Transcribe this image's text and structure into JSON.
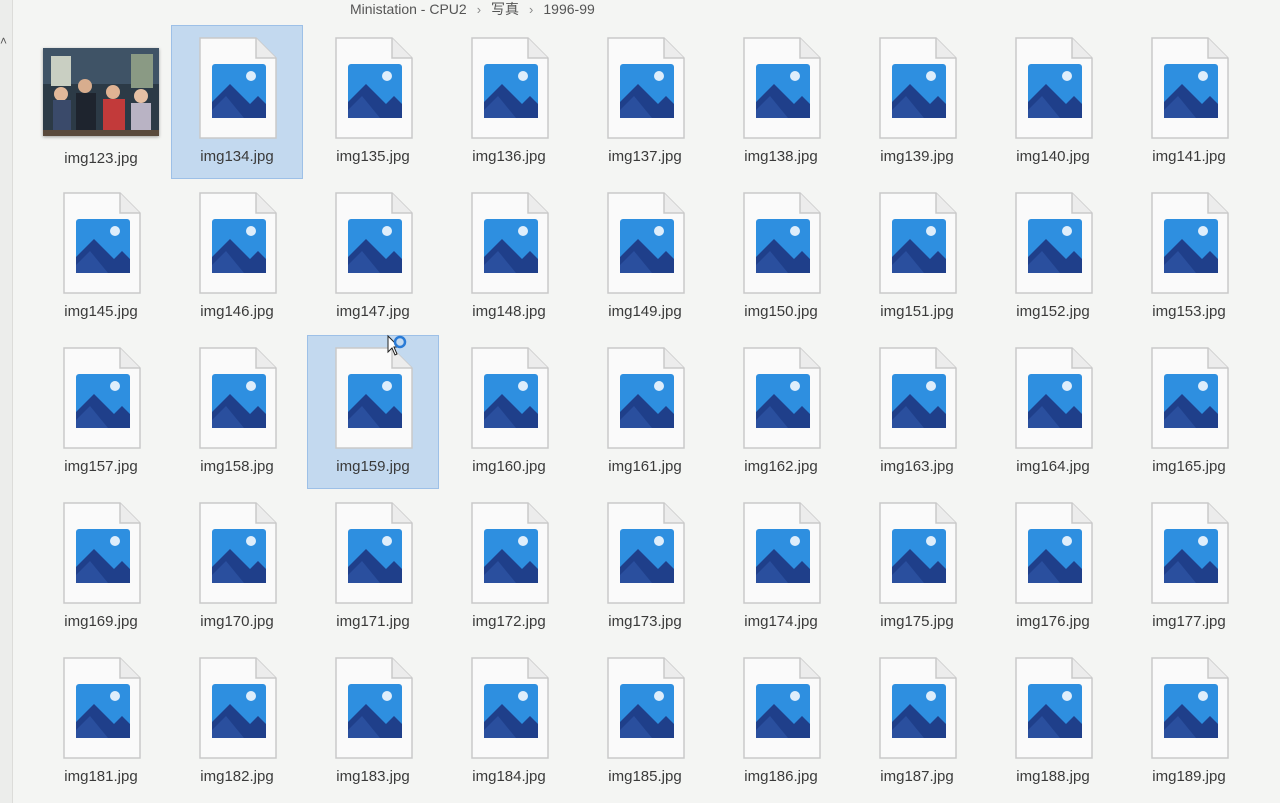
{
  "breadcrumb": {
    "items": [
      "Ministation - CPU2",
      "写真",
      "1996-99"
    ]
  },
  "files": [
    {
      "name": "img123.jpg",
      "kind": "photo",
      "selected": false
    },
    {
      "name": "img134.jpg",
      "kind": "image",
      "selected": true
    },
    {
      "name": "img135.jpg",
      "kind": "image",
      "selected": false
    },
    {
      "name": "img136.jpg",
      "kind": "image",
      "selected": false
    },
    {
      "name": "img137.jpg",
      "kind": "image",
      "selected": false
    },
    {
      "name": "img138.jpg",
      "kind": "image",
      "selected": false
    },
    {
      "name": "img139.jpg",
      "kind": "image",
      "selected": false
    },
    {
      "name": "img140.jpg",
      "kind": "image",
      "selected": false
    },
    {
      "name": "img141.jpg",
      "kind": "image",
      "selected": false
    },
    {
      "name": "img145.jpg",
      "kind": "image",
      "selected": false
    },
    {
      "name": "img146.jpg",
      "kind": "image",
      "selected": false
    },
    {
      "name": "img147.jpg",
      "kind": "image",
      "selected": false
    },
    {
      "name": "img148.jpg",
      "kind": "image",
      "selected": false
    },
    {
      "name": "img149.jpg",
      "kind": "image",
      "selected": false
    },
    {
      "name": "img150.jpg",
      "kind": "image",
      "selected": false
    },
    {
      "name": "img151.jpg",
      "kind": "image",
      "selected": false
    },
    {
      "name": "img152.jpg",
      "kind": "image",
      "selected": false
    },
    {
      "name": "img153.jpg",
      "kind": "image",
      "selected": false
    },
    {
      "name": "img157.jpg",
      "kind": "image",
      "selected": false
    },
    {
      "name": "img158.jpg",
      "kind": "image",
      "selected": false
    },
    {
      "name": "img159.jpg",
      "kind": "image",
      "selected": true
    },
    {
      "name": "img160.jpg",
      "kind": "image",
      "selected": false
    },
    {
      "name": "img161.jpg",
      "kind": "image",
      "selected": false
    },
    {
      "name": "img162.jpg",
      "kind": "image",
      "selected": false
    },
    {
      "name": "img163.jpg",
      "kind": "image",
      "selected": false
    },
    {
      "name": "img164.jpg",
      "kind": "image",
      "selected": false
    },
    {
      "name": "img165.jpg",
      "kind": "image",
      "selected": false
    },
    {
      "name": "img169.jpg",
      "kind": "image",
      "selected": false
    },
    {
      "name": "img170.jpg",
      "kind": "image",
      "selected": false
    },
    {
      "name": "img171.jpg",
      "kind": "image",
      "selected": false
    },
    {
      "name": "img172.jpg",
      "kind": "image",
      "selected": false
    },
    {
      "name": "img173.jpg",
      "kind": "image",
      "selected": false
    },
    {
      "name": "img174.jpg",
      "kind": "image",
      "selected": false
    },
    {
      "name": "img175.jpg",
      "kind": "image",
      "selected": false
    },
    {
      "name": "img176.jpg",
      "kind": "image",
      "selected": false
    },
    {
      "name": "img177.jpg",
      "kind": "image",
      "selected": false
    },
    {
      "name": "img181.jpg",
      "kind": "image",
      "selected": false
    },
    {
      "name": "img182.jpg",
      "kind": "image",
      "selected": false
    },
    {
      "name": "img183.jpg",
      "kind": "image",
      "selected": false
    },
    {
      "name": "img184.jpg",
      "kind": "image",
      "selected": false
    },
    {
      "name": "img185.jpg",
      "kind": "image",
      "selected": false
    },
    {
      "name": "img186.jpg",
      "kind": "image",
      "selected": false
    },
    {
      "name": "img187.jpg",
      "kind": "image",
      "selected": false
    },
    {
      "name": "img188.jpg",
      "kind": "image",
      "selected": false
    },
    {
      "name": "img189.jpg",
      "kind": "image",
      "selected": false
    }
  ],
  "icons": {
    "file": "image-file-icon",
    "photo": "photo-thumbnail-icon",
    "cursor": "busy-cursor-icon",
    "chevron": "chevron-up-icon"
  },
  "colors": {
    "selection": "#87b9eb",
    "icon_sky": "#2e8fe0",
    "icon_mountain": "#1f3f8a"
  }
}
